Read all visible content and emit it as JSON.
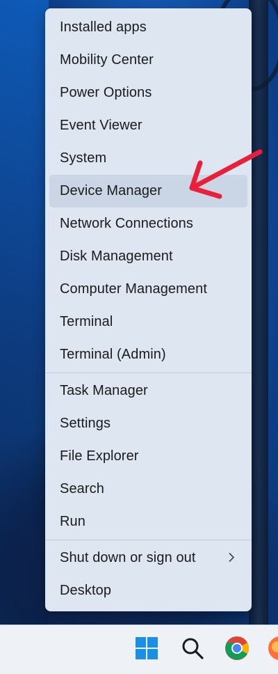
{
  "context_menu": {
    "section1": [
      {
        "label": "Installed apps"
      },
      {
        "label": "Mobility Center"
      },
      {
        "label": "Power Options"
      },
      {
        "label": "Event Viewer"
      },
      {
        "label": "System"
      },
      {
        "label": "Device Manager",
        "highlighted": true
      },
      {
        "label": "Network Connections"
      },
      {
        "label": "Disk Management"
      },
      {
        "label": "Computer Management"
      },
      {
        "label": "Terminal"
      },
      {
        "label": "Terminal (Admin)"
      }
    ],
    "section2": [
      {
        "label": "Task Manager"
      },
      {
        "label": "Settings"
      },
      {
        "label": "File Explorer"
      },
      {
        "label": "Search"
      },
      {
        "label": "Run"
      }
    ],
    "section3": [
      {
        "label": "Shut down or sign out",
        "submenu_icon": "chevron-right-icon"
      },
      {
        "label": "Desktop"
      }
    ]
  },
  "taskbar": {
    "icons": [
      "windows-start-icon",
      "search-icon",
      "chrome-icon",
      "firefox-icon"
    ]
  },
  "colors": {
    "menu_bg": "#dde6f1",
    "menu_highlight": "#cad6e6",
    "annotation_arrow": "#e8203a",
    "taskbar_bg": "#eef1f5"
  }
}
